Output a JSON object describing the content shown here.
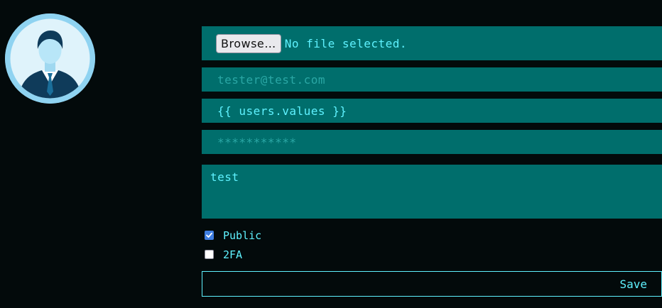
{
  "colors": {
    "background": "#030a0b",
    "field_bg": "#006e6c",
    "text_accent": "#5ff2ff",
    "placeholder": "#2aa7a5",
    "avatar_ring": "#8fd3f1"
  },
  "avatar": {
    "icon": "user-avatar-icon"
  },
  "file_input": {
    "button_label": "Browse…",
    "status": "No file selected."
  },
  "email_field": {
    "placeholder": "tester@test.com"
  },
  "name_field": {
    "value": "{{ users.values }}"
  },
  "password_field": {
    "placeholder": "***********"
  },
  "bio_field": {
    "value": "test"
  },
  "checkboxes": [
    {
      "label": "Public",
      "checked": true
    },
    {
      "label": "2FA",
      "checked": false
    }
  ],
  "save_button": {
    "label": "Save"
  }
}
